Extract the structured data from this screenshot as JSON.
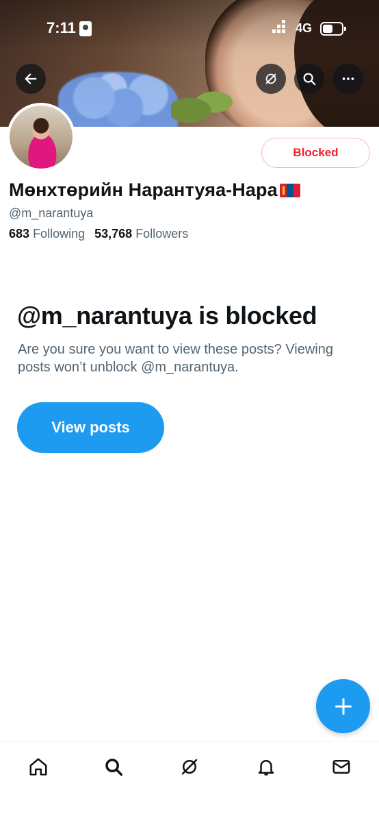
{
  "status_bar": {
    "time": "7:11",
    "network": "4G"
  },
  "header_actions": {
    "back_icon": "arrow-left-icon",
    "grok_icon": "grok-icon",
    "search_icon": "search-icon",
    "more_icon": "more-horizontal-icon"
  },
  "profile": {
    "display_name": "Мөнхтөрийн Нарантуяа-Нара",
    "flag": "mongolia-flag",
    "handle": "@m_narantuya",
    "following_count": "683",
    "following_label": "Following",
    "followers_count": "53,768",
    "followers_label": "Followers",
    "blocked_button_label": "Blocked"
  },
  "blocked_notice": {
    "title": "@m_narantuya is blocked",
    "description": "Are you sure you want to view these posts? Viewing posts won’t unblock @m_narantuya.",
    "view_button_label": "View posts"
  },
  "fab": {
    "icon": "plus-icon"
  },
  "bottom_nav": [
    {
      "name": "home",
      "icon": "home-icon"
    },
    {
      "name": "search",
      "icon": "search-icon"
    },
    {
      "name": "grok",
      "icon": "grok-icon"
    },
    {
      "name": "notifications",
      "icon": "bell-icon"
    },
    {
      "name": "messages",
      "icon": "mail-icon"
    }
  ],
  "colors": {
    "accent": "#1d9bf0",
    "blocked_red": "#f4212e",
    "secondary_text": "#536471"
  }
}
